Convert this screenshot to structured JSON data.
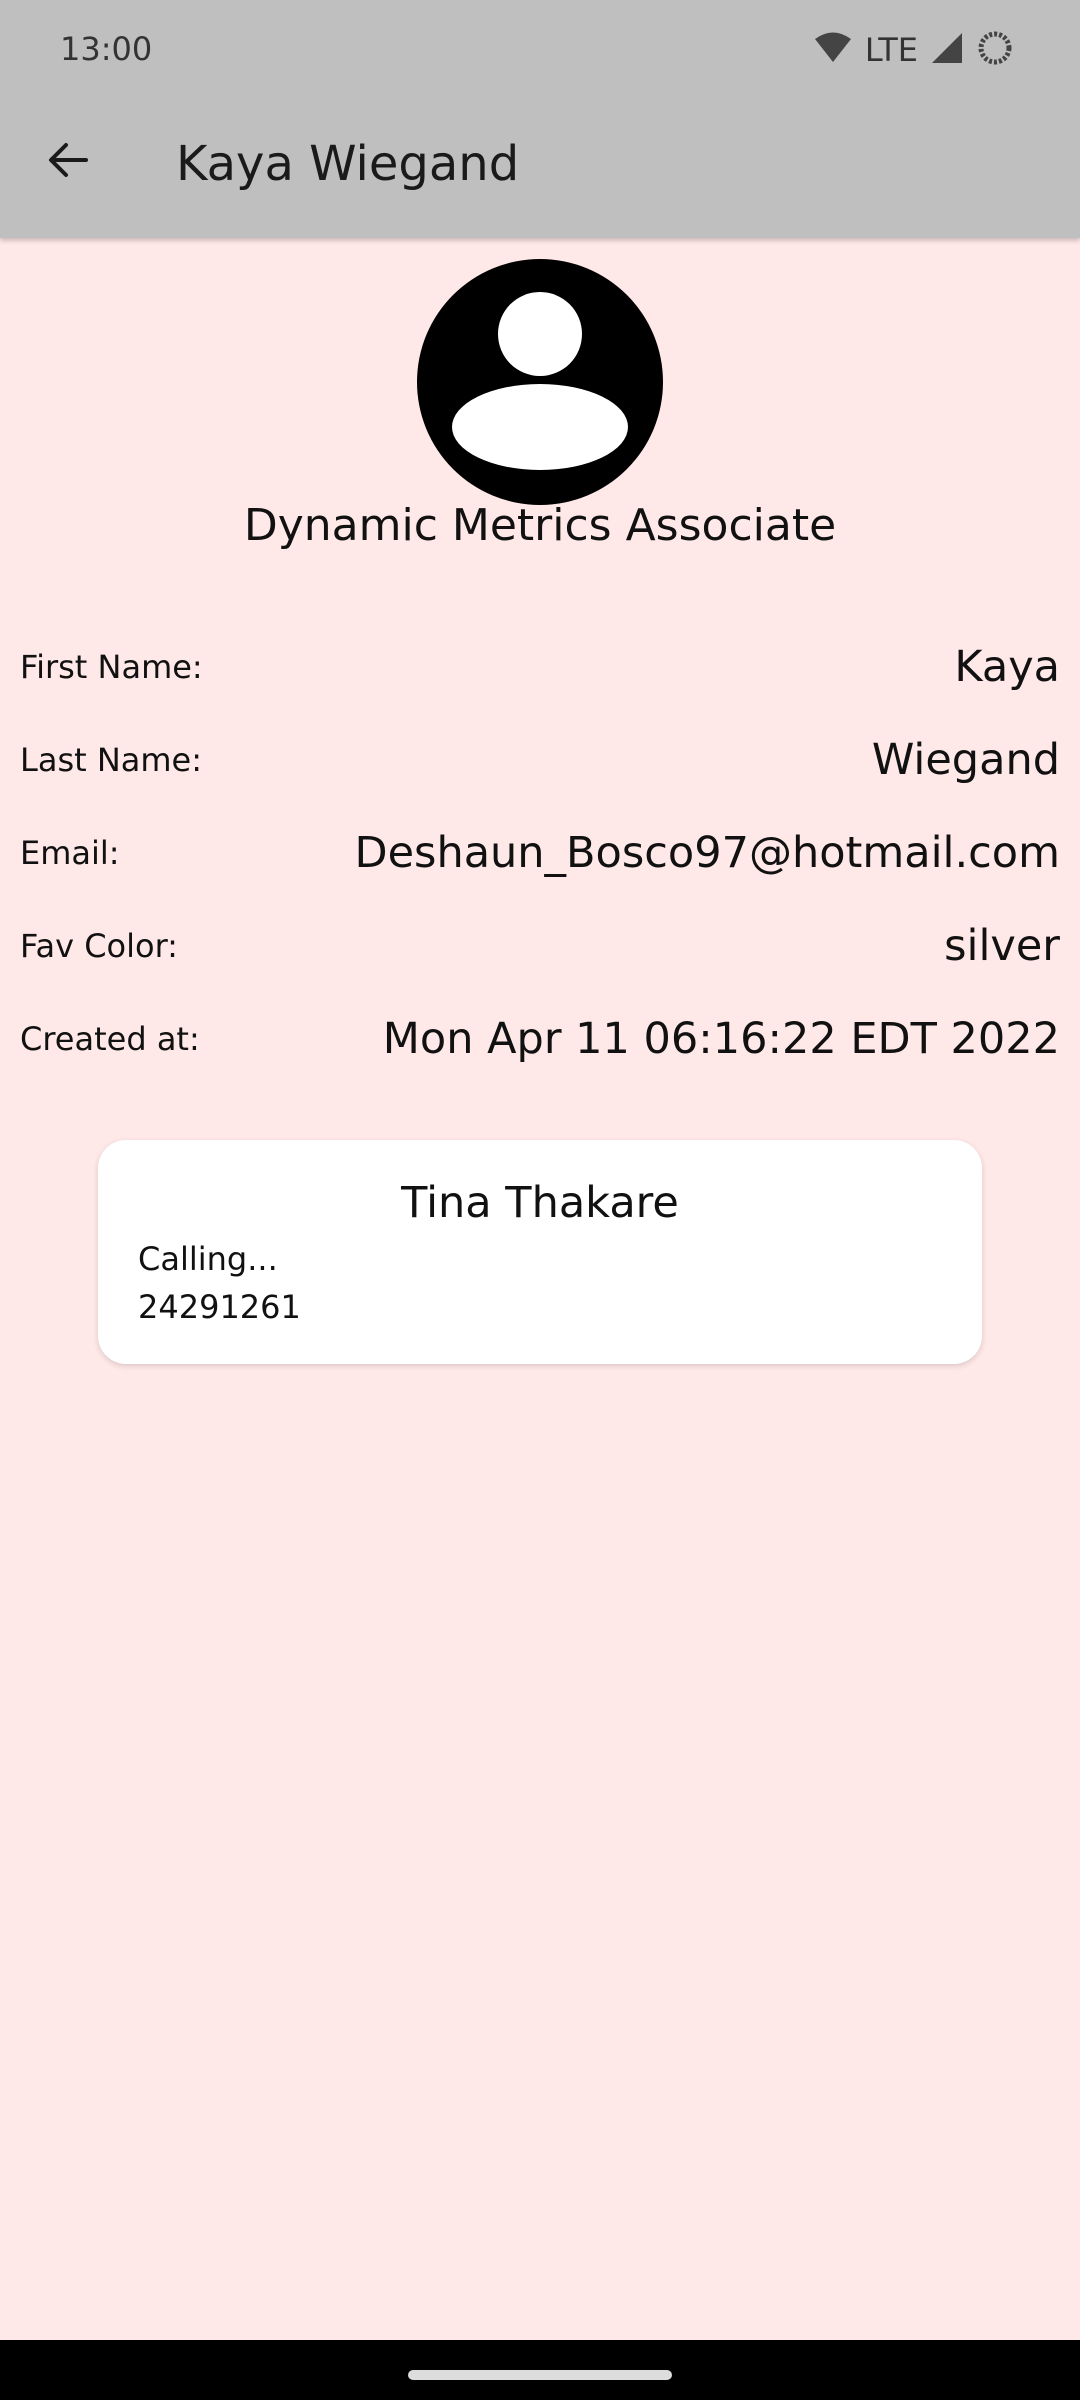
{
  "status_bar": {
    "time": "13:00",
    "network_label": "LTE",
    "icons": [
      "wifi-icon",
      "signal-icon",
      "battery-icon"
    ]
  },
  "app_bar": {
    "title": "Kaya Wiegand",
    "back_icon": "arrow-back-icon"
  },
  "profile": {
    "avatar_icon": "account-circle-icon",
    "job_title": "Dynamic Metrics Associate",
    "fields": [
      {
        "label": "First Name:",
        "value": "Kaya"
      },
      {
        "label": "Last Name:",
        "value": "Wiegand"
      },
      {
        "label": "Email:",
        "value": "Deshaun_Bosco97@hotmail.com"
      },
      {
        "label": "Fav Color:",
        "value": "silver"
      },
      {
        "label": "Created at:",
        "value": "Mon Apr 11 06:16:22 EDT 2022"
      }
    ]
  },
  "call_card": {
    "name": "Tina Thakare",
    "status": "Calling...",
    "number": "24291261"
  },
  "colors": {
    "background": "#ffe8e8",
    "app_bar": "#bfbfbf",
    "card": "#ffffff"
  }
}
